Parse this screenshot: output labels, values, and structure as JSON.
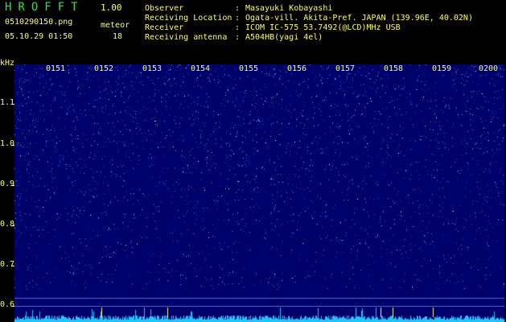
{
  "header": {
    "app_title": "HROFFT",
    "version": "1.00",
    "filename": "0510290150.png",
    "datetime": "05.10.29 01:50",
    "meteor_label": "meteor",
    "meteor_count": "18"
  },
  "info": [
    {
      "label": "Observer",
      "value": "Masayuki Kobayashi"
    },
    {
      "label": "Receiving Location",
      "value": "Ogata-vill. Akita-Pref. JAPAN (139.96E, 40.02N)"
    },
    {
      "label": "Receiver",
      "value": "ICOM IC-575 53.7492(@LCD)MHz USB"
    },
    {
      "label": "Receiving antenna",
      "value": "A504HB(yagi 4el)"
    }
  ],
  "axis": {
    "unit": "kHz",
    "labels": [
      "1.1",
      "1.0",
      "0.9",
      "0.8",
      "0.7",
      "0.6"
    ]
  },
  "time_labels": [
    "0151",
    "0152",
    "0153",
    "0154",
    "0155",
    "0156",
    "0157",
    "0158",
    "0159",
    "0200"
  ],
  "colors": {
    "text": "#ffff66",
    "title": "#34e234",
    "background": "#00006a",
    "noise": "#4a8cff",
    "baseline": "#19c8ff"
  }
}
